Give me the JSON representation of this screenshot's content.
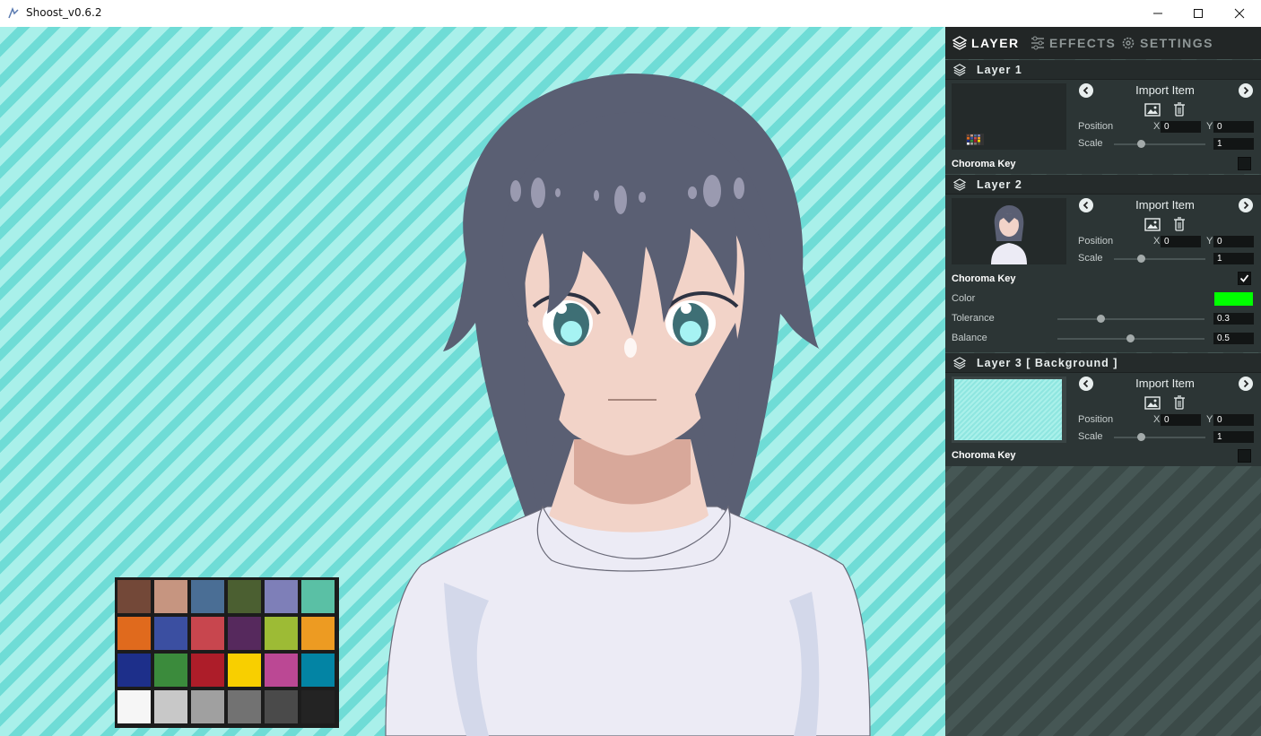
{
  "window": {
    "title": "Shoost_v0.6.2",
    "icon": "shoost-app-icon",
    "controls": [
      "minimize-icon",
      "maximize-icon",
      "close-icon"
    ]
  },
  "palette": {
    "colors": [
      "#734838",
      "#c69580",
      "#4a6e95",
      "#4b5f31",
      "#7e7fb8",
      "#5ac0a5",
      "#e06a1d",
      "#3b4fa1",
      "#c8464e",
      "#56295d",
      "#9dbb35",
      "#ed9b22",
      "#1d2f8a",
      "#3b8b3c",
      "#ad1d29",
      "#f8cf00",
      "#bb4894",
      "#0384a4",
      "#f6f6f6",
      "#c8c8c8",
      "#a0a0a0",
      "#727272",
      "#4a4a4a",
      "#232323"
    ]
  },
  "panel": {
    "tabs": [
      {
        "label": "LAYER",
        "icon": "layers-icon",
        "active": true
      },
      {
        "label": "EFFECTS",
        "icon": "sliders-icon",
        "active": false
      },
      {
        "label": "SETTINGS",
        "icon": "gear-icon",
        "active": false
      }
    ],
    "layers": [
      {
        "title": "Layer 1",
        "import_label": "Import Item",
        "position_label": "Position",
        "x_label": "X",
        "x_value": "0",
        "y_label": "Y",
        "y_value": "0",
        "scale_label": "Scale",
        "scale_value": "1",
        "chroma_label": "Choroma Key",
        "chroma_checked": false
      },
      {
        "title": "Layer 2",
        "import_label": "Import Item",
        "position_label": "Position",
        "x_label": "X",
        "x_value": "0",
        "y_label": "Y",
        "y_value": "0",
        "scale_label": "Scale",
        "scale_value": "1",
        "chroma_label": "Choroma Key",
        "chroma_checked": true,
        "color_label": "Color",
        "key_color": "#00ff00",
        "tolerance_label": "Tolerance",
        "tolerance_value": "0.3",
        "balance_label": "Balance",
        "balance_value": "0.5"
      },
      {
        "title": "Layer 3 [ Background ]",
        "import_label": "Import Item",
        "position_label": "Position",
        "x_label": "X",
        "x_value": "0",
        "y_label": "Y",
        "y_value": "0",
        "scale_label": "Scale",
        "scale_value": "1",
        "chroma_label": "Choroma Key",
        "chroma_checked": false
      }
    ]
  }
}
